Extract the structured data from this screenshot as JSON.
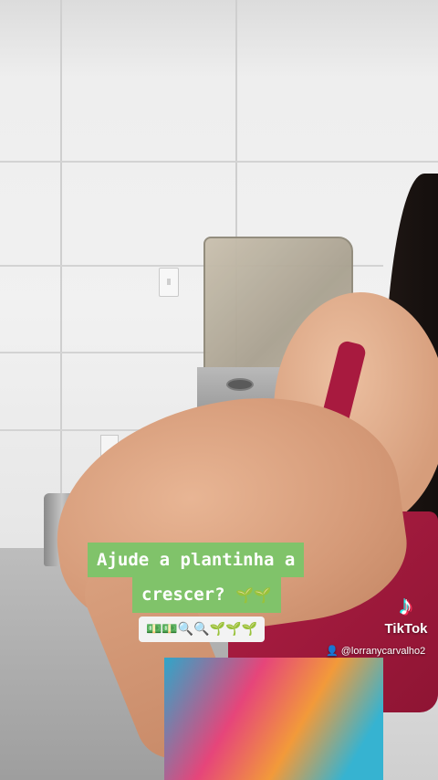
{
  "caption": {
    "line1": "Ajude a plantinha a",
    "line2": "crescer?",
    "line2_emoji": "🌱🌱",
    "emoji_row": "💵💵🔍🔍🌱🌱🌱"
  },
  "watermark": {
    "logo_icon": "tiktok-note-icon",
    "logo_glyph": "♪",
    "brand": "TikTok",
    "user_icon": "person-icon",
    "user_glyph": "👤",
    "handle": "@lorranycarvalho2"
  },
  "colors": {
    "caption_bg": "#80c36a",
    "caption_text": "#ffffff",
    "top_color": "#a81a3f"
  }
}
